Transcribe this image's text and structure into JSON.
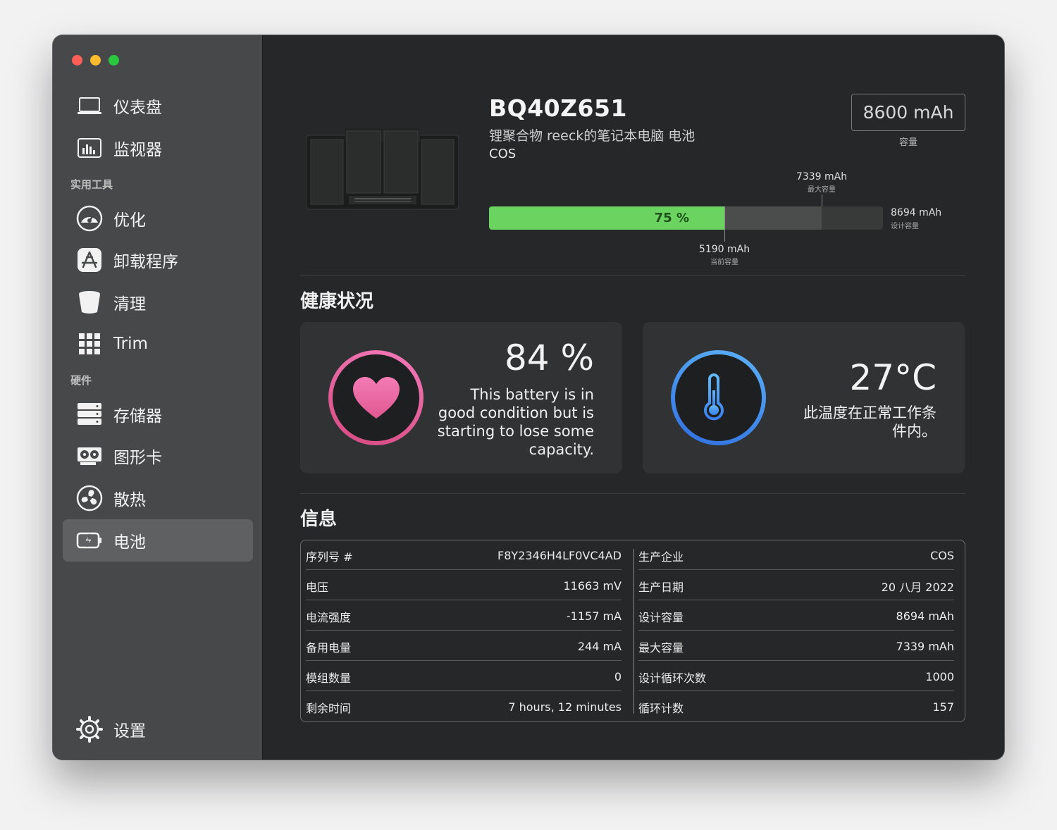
{
  "sidebar": {
    "items": [
      {
        "label": "仪表盘",
        "icon": "laptop-icon"
      },
      {
        "label": "监视器",
        "icon": "monitor-chart-icon"
      },
      {
        "label": "优化",
        "icon": "gauge-icon"
      },
      {
        "label": "卸载程序",
        "icon": "app-store-icon"
      },
      {
        "label": "清理",
        "icon": "trash-bin-icon"
      },
      {
        "label": "Trim",
        "icon": "grid-icon"
      },
      {
        "label": "存储器",
        "icon": "storage-drives-icon"
      },
      {
        "label": "图形卡",
        "icon": "graphics-card-icon"
      },
      {
        "label": "散热",
        "icon": "fan-icon"
      },
      {
        "label": "电池",
        "icon": "battery-charge-icon",
        "active": true
      }
    ],
    "section_utilities": "实用工具",
    "section_hardware": "硬件",
    "settings_label": "设置"
  },
  "battery": {
    "model": "BQ40Z651",
    "subtitle": "锂聚合物 reeck的笔记本电脑 电池",
    "maker": "COS",
    "capacity_value": "8600 mAh",
    "capacity_label": "容量",
    "percent_label": "75 %",
    "current_fraction": 0.597,
    "max_fraction": 0.844,
    "marker_max_value": "7339 mAh",
    "marker_max_label": "最大容量",
    "marker_design_value": "8694 mAh",
    "marker_design_label": "设计容量",
    "marker_current_value": "5190 mAh",
    "marker_current_label": "当前容量"
  },
  "health": {
    "title": "健康状况",
    "condition_value": "84 %",
    "condition_text_lines": [
      "This battery is in",
      "good condition but is",
      "starting to lose some",
      "capacity."
    ],
    "temp_value": "27°C",
    "temp_text_lines": [
      "此温度在正常工作条",
      "件内。"
    ]
  },
  "info": {
    "title": "信息",
    "left": [
      {
        "k": "序列号 #",
        "v": "F8Y2346H4LF0VC4AD"
      },
      {
        "k": "电压",
        "v": "11663 mV"
      },
      {
        "k": "电流强度",
        "v": "-1157 mA"
      },
      {
        "k": "备用电量",
        "v": "244 mA"
      },
      {
        "k": "模组数量",
        "v": "0"
      },
      {
        "k": "剩余时间",
        "v": "7 hours, 12 minutes"
      }
    ],
    "right": [
      {
        "k": "生产企业",
        "v": "COS"
      },
      {
        "k": "生产日期",
        "v": "20 八月 2022"
      },
      {
        "k": "设计容量",
        "v": "8694 mAh"
      },
      {
        "k": "最大容量",
        "v": "7339 mAh"
      },
      {
        "k": "设计循环次数",
        "v": "1000"
      },
      {
        "k": "循环计数",
        "v": "157"
      }
    ]
  },
  "colors": {
    "accent_green": "#6bd360",
    "heart_pink": "#e65a9a",
    "thermo_blue": "#3a8ef0"
  }
}
